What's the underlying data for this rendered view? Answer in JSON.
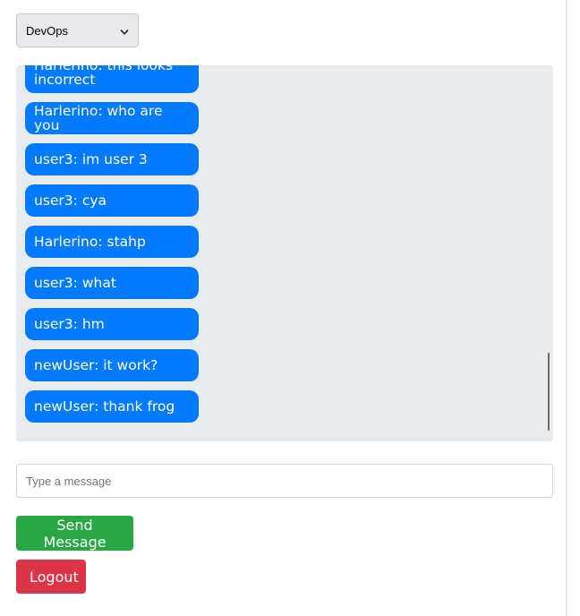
{
  "room_select": {
    "selected": "DevOps",
    "icon": "chevron-down-icon"
  },
  "messages": [
    {
      "text": "Harlerino: this looks incorrect"
    },
    {
      "text": "Harlerino: who are you"
    },
    {
      "text": "user3: im user 3"
    },
    {
      "text": "user3: cya"
    },
    {
      "text": "Harlerino: stahp"
    },
    {
      "text": "user3: what"
    },
    {
      "text": "user3: hm"
    },
    {
      "text": "newUser: it work?"
    },
    {
      "text": "newUser: thank frog"
    }
  ],
  "message_input": {
    "placeholder": "Type a message",
    "value": ""
  },
  "buttons": {
    "send_label": "Send Message",
    "logout_label": "Logout"
  },
  "colors": {
    "message_bubble": "#007bff",
    "chat_background": "#e9ecef",
    "send_button": "#28a745",
    "logout_button": "#dc3545"
  }
}
